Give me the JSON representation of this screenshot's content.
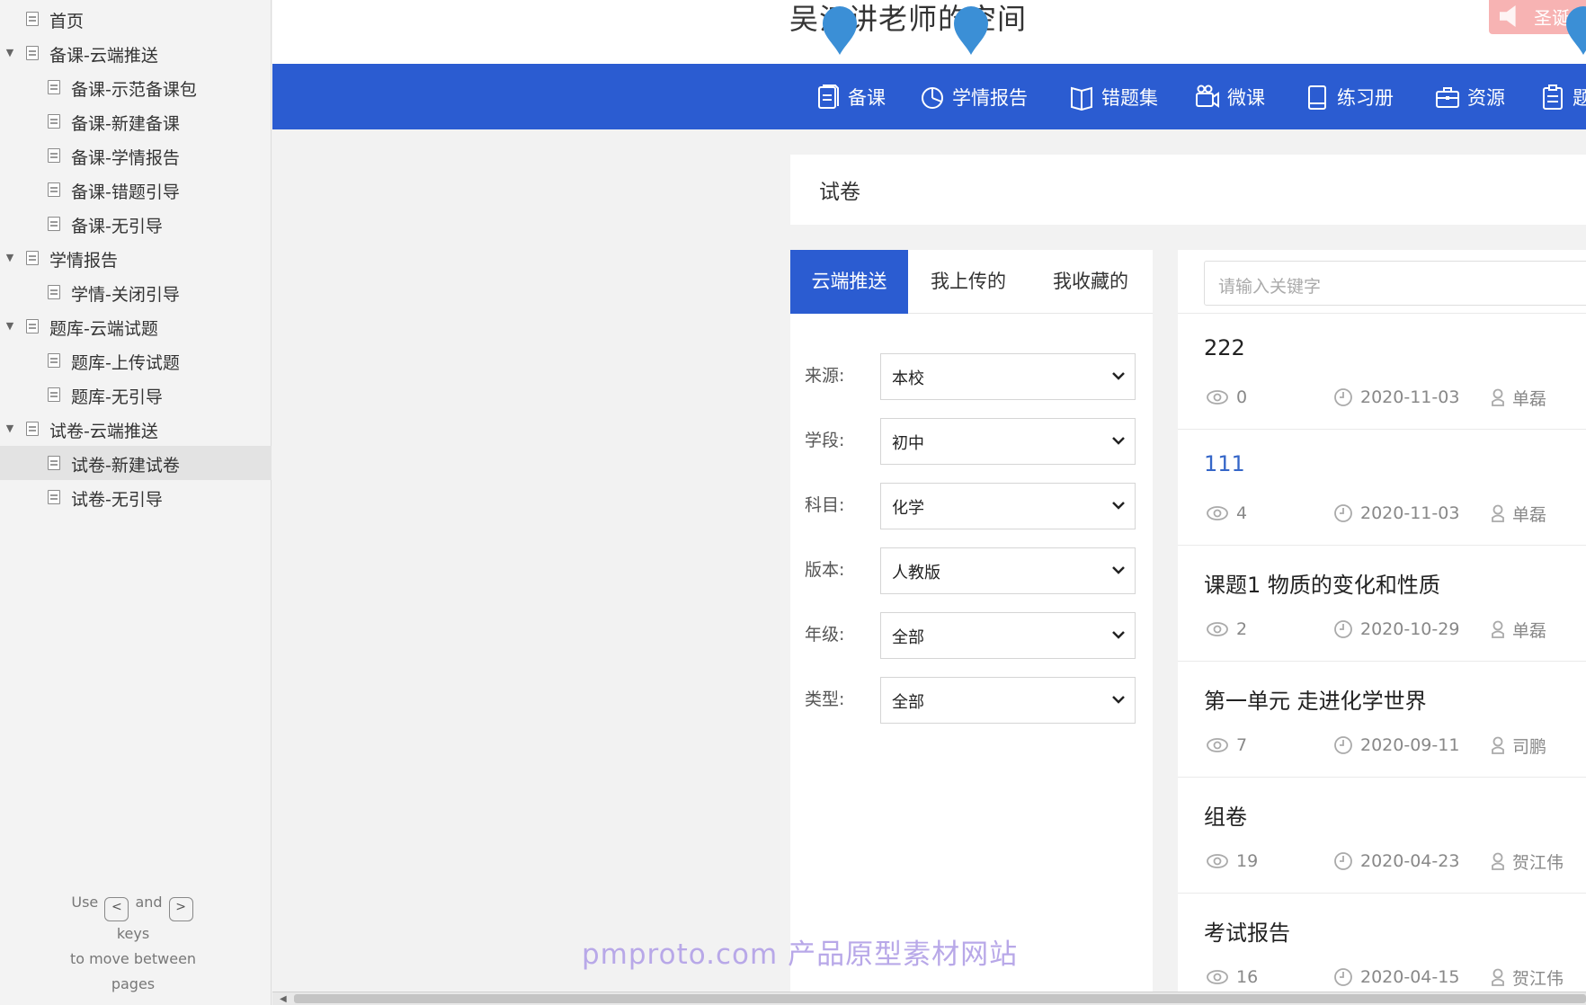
{
  "sidebar": {
    "items": [
      {
        "label": "首页",
        "level": 0,
        "expanded": false,
        "selected": false
      },
      {
        "label": "备课-云端推送",
        "level": 0,
        "expanded": true,
        "selected": false
      },
      {
        "label": "备课-示范备课包",
        "level": 1,
        "selected": false
      },
      {
        "label": "备课-新建备课",
        "level": 1,
        "selected": false
      },
      {
        "label": "备课-学情报告",
        "level": 1,
        "selected": false
      },
      {
        "label": "备课-错题引导",
        "level": 1,
        "selected": false
      },
      {
        "label": "备课-无引导",
        "level": 1,
        "selected": false
      },
      {
        "label": "学情报告",
        "level": 0,
        "expanded": true,
        "selected": false
      },
      {
        "label": "学情-关闭引导",
        "level": 1,
        "selected": false
      },
      {
        "label": "题库-云端试题",
        "level": 0,
        "expanded": true,
        "selected": false
      },
      {
        "label": "题库-上传试题",
        "level": 1,
        "selected": false
      },
      {
        "label": "题库-无引导",
        "level": 1,
        "selected": false
      },
      {
        "label": "试卷-云端推送",
        "level": 0,
        "expanded": true,
        "selected": false
      },
      {
        "label": "试卷-新建试卷",
        "level": 1,
        "selected": true
      },
      {
        "label": "试卷-无引导",
        "level": 1,
        "selected": false
      }
    ],
    "hint": {
      "use": "Use",
      "and": "and",
      "keys": "keys",
      "move": "to move between",
      "pages": "pages",
      "prev_key": "<",
      "next_key": ">"
    }
  },
  "header": {
    "space_title": "吴江讲老师的空间",
    "badge_text": "圣诞"
  },
  "navbar": {
    "items": [
      {
        "label": "备课",
        "icon": "lesson-doc-icon"
      },
      {
        "label": "学情报告",
        "icon": "pie-chart-icon"
      },
      {
        "label": "错题集",
        "icon": "open-book-icon"
      },
      {
        "label": "微课",
        "icon": "video-camera-icon"
      },
      {
        "label": "练习册",
        "icon": "notebook-icon"
      },
      {
        "label": "资源",
        "icon": "briefcase-icon"
      },
      {
        "label": "题",
        "icon": "clipboard-icon"
      }
    ]
  },
  "page": {
    "section_title": "试卷"
  },
  "tabs": [
    {
      "label": "云端推送",
      "active": true
    },
    {
      "label": "我上传的",
      "active": false
    },
    {
      "label": "我收藏的",
      "active": false
    }
  ],
  "filters": [
    {
      "label": "来源:",
      "value": "本校"
    },
    {
      "label": "学段:",
      "value": "初中"
    },
    {
      "label": "科目:",
      "value": "化学"
    },
    {
      "label": "版本:",
      "value": "人教版"
    },
    {
      "label": "年级:",
      "value": "全部"
    },
    {
      "label": "类型:",
      "value": "全部"
    }
  ],
  "search": {
    "placeholder": "请输入关键字"
  },
  "results": [
    {
      "title": "222",
      "views": "0",
      "date": "2020-11-03",
      "author": "单磊",
      "link": false
    },
    {
      "title": "111",
      "views": "4",
      "date": "2020-11-03",
      "author": "单磊",
      "link": true
    },
    {
      "title": "课题1 物质的变化和性质",
      "views": "2",
      "date": "2020-10-29",
      "author": "单磊",
      "link": false
    },
    {
      "title": "第一单元 走进化学世界",
      "views": "7",
      "date": "2020-09-11",
      "author": "司鹏",
      "link": false
    },
    {
      "title": "组卷",
      "views": "19",
      "date": "2020-04-23",
      "author": "贺江伟",
      "link": false
    },
    {
      "title": "考试报告",
      "views": "16",
      "date": "2020-04-15",
      "author": "贺江伟",
      "link": false
    }
  ],
  "watermark": "pmproto.com 产品原型素材网站",
  "colors": {
    "primary": "#2b5cd1",
    "link": "#3566c8",
    "pin": "#3b8fd6",
    "badge": "#f7b3b3"
  }
}
